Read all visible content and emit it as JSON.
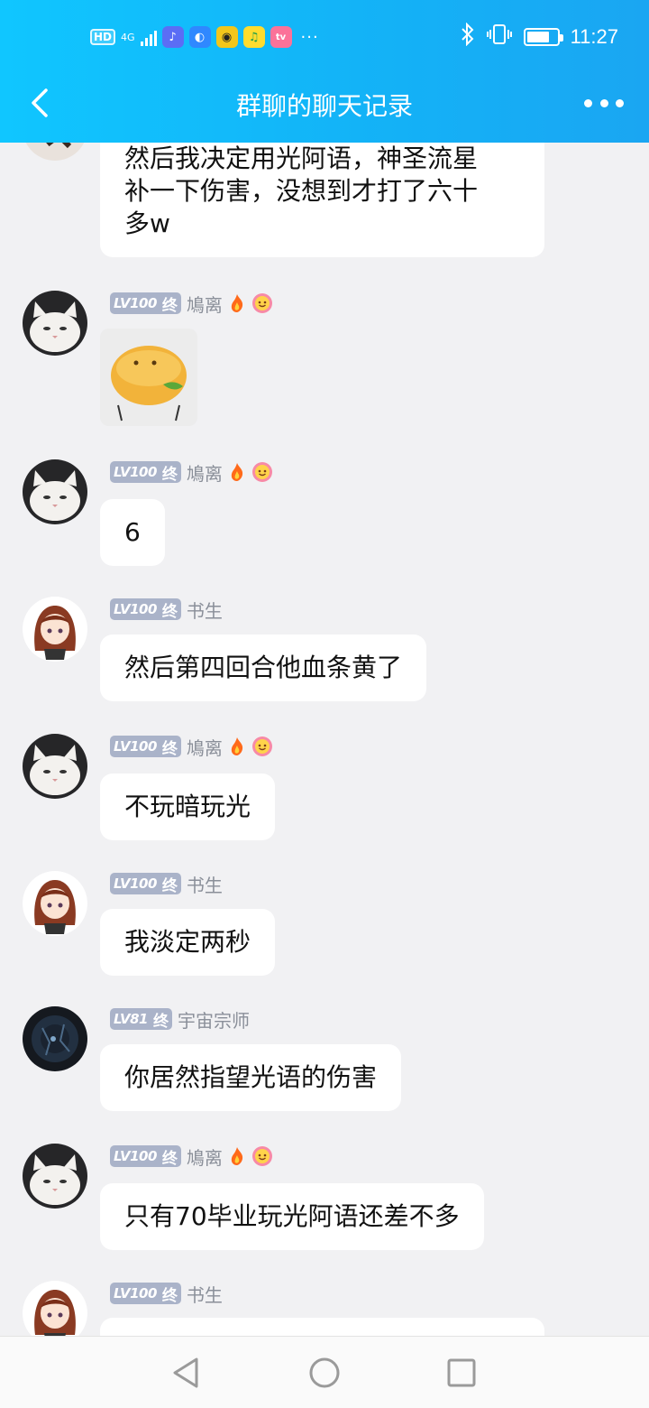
{
  "status_bar": {
    "hd": "HD",
    "network": "4G",
    "more": "···",
    "time": "11:27",
    "battery_level": 0.75
  },
  "header": {
    "title": "群聊的聊天记录"
  },
  "messages": [
    {
      "text_lines": [
        "然后我决定用光阿语，神圣流星",
        "补一下伤害，没想到才打了六十",
        "多w"
      ]
    },
    {
      "level": "LV100",
      "tier": "终",
      "nickname": "鳩离",
      "sticker": "sticker-smile-face"
    },
    {
      "level": "LV100",
      "tier": "终",
      "nickname": "鳩离",
      "text": "6"
    },
    {
      "level": "LV100",
      "tier": "终",
      "nickname": "书生",
      "text": "然后第四回合他血条黄了"
    },
    {
      "level": "LV100",
      "tier": "终",
      "nickname": "鳩离",
      "text": "不玩暗玩光"
    },
    {
      "level": "LV100",
      "tier": "终",
      "nickname": "书生",
      "text": "我淡定两秒"
    },
    {
      "level": "LV81",
      "tier": "终",
      "nickname": "宇宙宗师",
      "text": "你居然指望光语的伤害"
    },
    {
      "level": "LV100",
      "tier": "终",
      "nickname": "鳩离",
      "text": "只有70毕业玩光阿语还差不多"
    },
    {
      "level": "LV100",
      "tier": "终",
      "nickname": "书生",
      "text": ""
    }
  ],
  "colors": {
    "header_start": "#10c6ff",
    "header_end": "#1aa6f2",
    "level_badge": "#aab3c9",
    "background": "#f1f1f3"
  }
}
